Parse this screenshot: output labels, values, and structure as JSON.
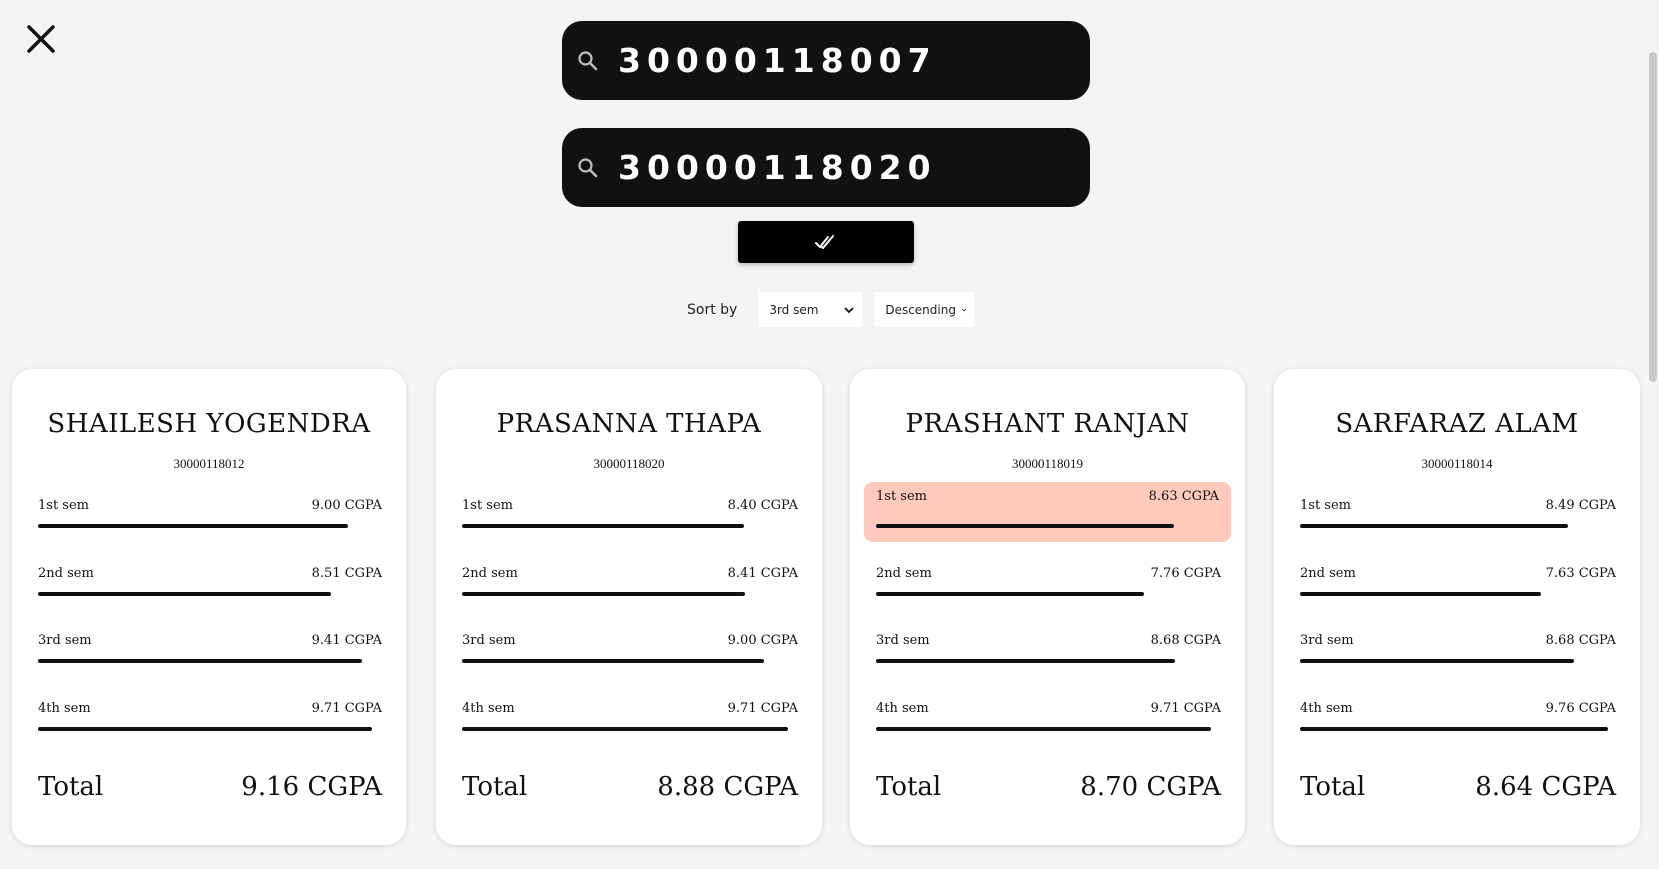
{
  "search": {
    "first_value": "30000118007",
    "second_value": "30000118020"
  },
  "sort": {
    "label": "Sort by",
    "field_selected": "3rd sem",
    "order_selected": "Descending"
  },
  "cards": [
    {
      "name": "SHAILESH YOGENDRA",
      "roll": "30000118012",
      "highlighted_sem": null,
      "sems": [
        {
          "label": "1st sem",
          "value": "9.00 CGPA",
          "cgpa": 9.0
        },
        {
          "label": "2nd sem",
          "value": "8.51 CGPA",
          "cgpa": 8.51
        },
        {
          "label": "3rd sem",
          "value": "9.41 CGPA",
          "cgpa": 9.41
        },
        {
          "label": "4th sem",
          "value": "9.71 CGPA",
          "cgpa": 9.71
        }
      ],
      "total_label": "Total",
      "total_value": "9.16 CGPA"
    },
    {
      "name": "PRASANNA THAPA",
      "roll": "30000118020",
      "highlighted_sem": null,
      "sems": [
        {
          "label": "1st sem",
          "value": "8.40 CGPA",
          "cgpa": 8.4
        },
        {
          "label": "2nd sem",
          "value": "8.41 CGPA",
          "cgpa": 8.41
        },
        {
          "label": "3rd sem",
          "value": "9.00 CGPA",
          "cgpa": 9.0
        },
        {
          "label": "4th sem",
          "value": "9.71 CGPA",
          "cgpa": 9.71
        }
      ],
      "total_label": "Total",
      "total_value": "8.88 CGPA"
    },
    {
      "name": "PRASHANT RANJAN",
      "roll": "30000118019",
      "highlighted_sem": 0,
      "sems": [
        {
          "label": "1st sem",
          "value": "8.63 CGPA",
          "cgpa": 8.63
        },
        {
          "label": "2nd sem",
          "value": "7.76 CGPA",
          "cgpa": 7.76
        },
        {
          "label": "3rd sem",
          "value": "8.68 CGPA",
          "cgpa": 8.68
        },
        {
          "label": "4th sem",
          "value": "9.71 CGPA",
          "cgpa": 9.71
        }
      ],
      "total_label": "Total",
      "total_value": "8.70 CGPA"
    },
    {
      "name": "SARFARAZ ALAM",
      "roll": "30000118014",
      "highlighted_sem": null,
      "sems": [
        {
          "label": "1st sem",
          "value": "8.49 CGPA",
          "cgpa": 8.49
        },
        {
          "label": "2nd sem",
          "value": "7.63 CGPA",
          "cgpa": 7.63
        },
        {
          "label": "3rd sem",
          "value": "8.68 CGPA",
          "cgpa": 8.68
        },
        {
          "label": "4th sem",
          "value": "9.76 CGPA",
          "cgpa": 9.76
        }
      ],
      "total_label": "Total",
      "total_value": "8.64 CGPA"
    }
  ],
  "colors": {
    "highlight": "#ffc9be",
    "search_bg": "#111111",
    "page_bg": "#f4f4f4"
  }
}
